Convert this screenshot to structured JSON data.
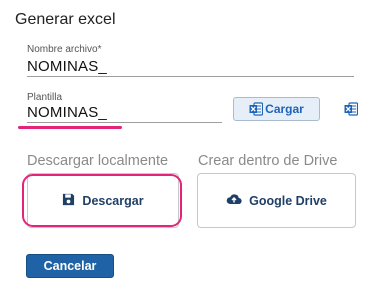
{
  "dialog": {
    "title": "Generar excel"
  },
  "nombre_archivo": {
    "label": "Nombre archivo",
    "required_marker": "*",
    "value": "NOMINAS_"
  },
  "plantilla": {
    "label": "Plantilla",
    "value": "NOMINAS_"
  },
  "cargar_button": {
    "label": "Cargar",
    "icon": "excel-icon"
  },
  "sections": {
    "local": {
      "title": "Descargar localmente",
      "button_label": "Descargar",
      "icon": "save-icon"
    },
    "drive": {
      "title": "Crear dentro de Drive",
      "button_label": "Google Drive",
      "icon": "cloud-upload-icon"
    }
  },
  "cancel_button": {
    "label": "Cancelar"
  },
  "colors": {
    "accent": "#1e63b8",
    "highlight": "#e4237a",
    "primary_button": "#1f63a6"
  }
}
